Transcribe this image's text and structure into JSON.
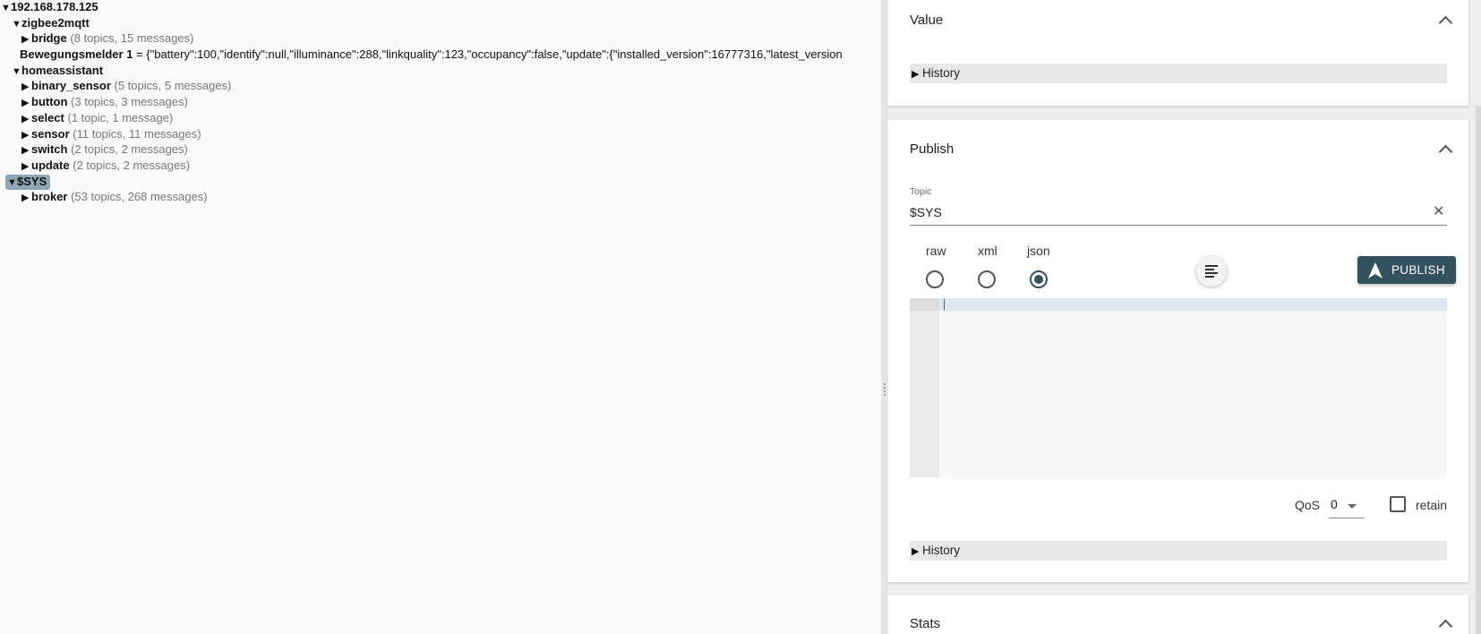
{
  "tree": {
    "root": "192.168.178.125",
    "zigbee2mqtt": {
      "name": "zigbee2mqtt",
      "bridge": {
        "name": "bridge",
        "count": "(8 topics, 15 messages)"
      },
      "bewegungsmelder": {
        "name": "Bewegungsmelder 1",
        "value": " = {\"battery\":100,\"identify\":null,\"illuminance\":288,\"linkquality\":123,\"occupancy\":false,\"update\":{\"installed_version\":16777316,\"latest_version"
      }
    },
    "homeassistant": {
      "name": "homeassistant",
      "children": [
        {
          "name": "binary_sensor",
          "count": "(5 topics, 5 messages)"
        },
        {
          "name": "button",
          "count": "(3 topics, 3 messages)"
        },
        {
          "name": "select",
          "count": "(1 topic, 1 message)"
        },
        {
          "name": "sensor",
          "count": "(11 topics, 11 messages)"
        },
        {
          "name": "switch",
          "count": "(2 topics, 2 messages)"
        },
        {
          "name": "update",
          "count": "(2 topics, 2 messages)"
        }
      ]
    },
    "sys": {
      "name": "$SYS",
      "broker": {
        "name": "broker",
        "count": "(53 topics, 268 messages)"
      }
    }
  },
  "value_panel": {
    "title": "Value",
    "history": "History"
  },
  "publish_panel": {
    "title": "Publish",
    "topic_label": "Topic",
    "topic_value": "$SYS",
    "formats": [
      "raw",
      "xml",
      "json"
    ],
    "selected_format": "json",
    "publish_label": "PUBLISH",
    "qos_label": "QoS",
    "qos_value": "0",
    "retain_label": "retain",
    "history": "History"
  },
  "stats_panel": {
    "title": "Stats"
  },
  "colors": {
    "accent": "#34515e",
    "selection": "#8fa7b3"
  }
}
